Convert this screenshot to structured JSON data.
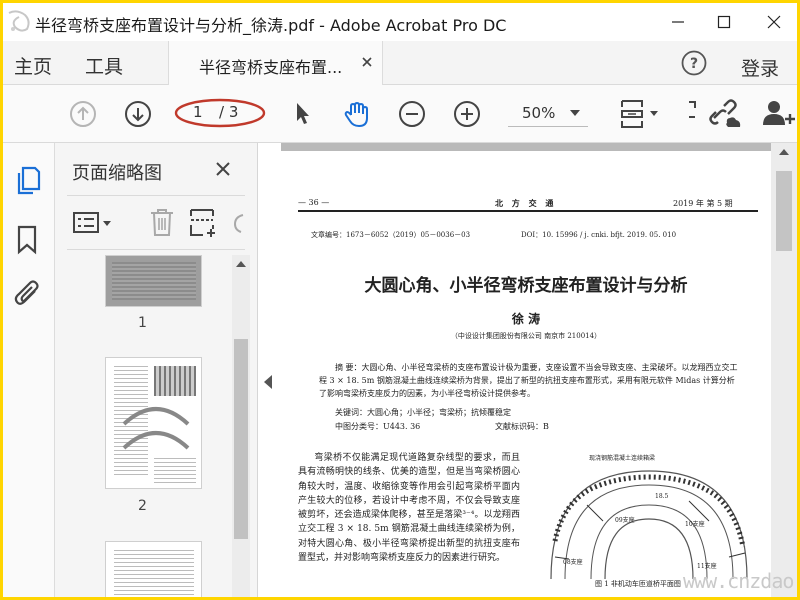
{
  "window": {
    "title": "半径弯桥支座布置设计与分析_徐涛.pdf - Adobe Acrobat Pro DC",
    "minimize_icon": "minimize-icon",
    "maximize_icon": "maximize-icon",
    "close_icon": "close-icon"
  },
  "menubar": {
    "home": "主页",
    "tools": "工具",
    "doc_tab": "半径弯桥支座布置...",
    "login": "登录"
  },
  "toolbar": {
    "current_page": "1",
    "total_pages": "/ 3",
    "zoom": "50%"
  },
  "panel": {
    "title": "页面缩略图",
    "thumbnails": [
      "1",
      "2"
    ]
  },
  "document": {
    "header_page": "— 36 —",
    "header_journal": "北 方 交 通",
    "header_issue": "2019 年  第 5 期",
    "article_no": "文章编号：1673－6052（2019）05－0036－03",
    "doi": "DOI：10. 15996 / j. cnki. bfjt. 2019. 05. 010",
    "title": "大圆心角、小半径弯桥支座布置设计与分析",
    "author": "徐  涛",
    "affiliation": "（中设设计集团股份有限公司   南京市   210014）",
    "abstract": "摘  要：大圆心角、小半径弯梁桥的支座布置设计极为重要，支座设置不当会导致支座、主梁破坏。以龙翔西立交工程 3 × 18. 5m 钢筋混凝土曲线连续梁桥为背景，提出了新型的抗扭支座布置形式，采用有限元软件 Midas 计算分析了影响弯梁桥支座反力的因素，为小半径弯桥设计提供参考。",
    "keywords": "关键词：大圆心角；小半径；弯梁桥；抗倾覆稳定",
    "class_no": "中图分类号：U443. 36",
    "doc_code": "文献标识码：B",
    "body": "弯梁桥不仅能满足现代道路复杂线型的要求，而且具有流畅明快的线条、优美的造型，但是当弯梁桥圆心角较大时，温度、收缩徐变等作用会引起弯梁桥平面内产生较大的位移，若设计中考虑不周，不仅会导致支座被剪坏，还会造成梁体爬移，甚至是落梁³⁻⁴。以龙翔西立交工程 3 × 18. 5m 钢筋混凝土曲线连续梁桥为例，对特大圆心角、极小半径弯梁桥提出新型的抗扭支座布置型式，并对影响弯梁桥支座反力的因素进行研究。",
    "figure_title": "现浇钢筋混凝土连续箱梁",
    "figure_caption": "图 1    非机动车匝道桥平面图",
    "figure_labels": [
      "18.5",
      "09支座",
      "10支座",
      "11支座",
      "08支座"
    ]
  },
  "watermark": "www.cnzdao.com"
}
